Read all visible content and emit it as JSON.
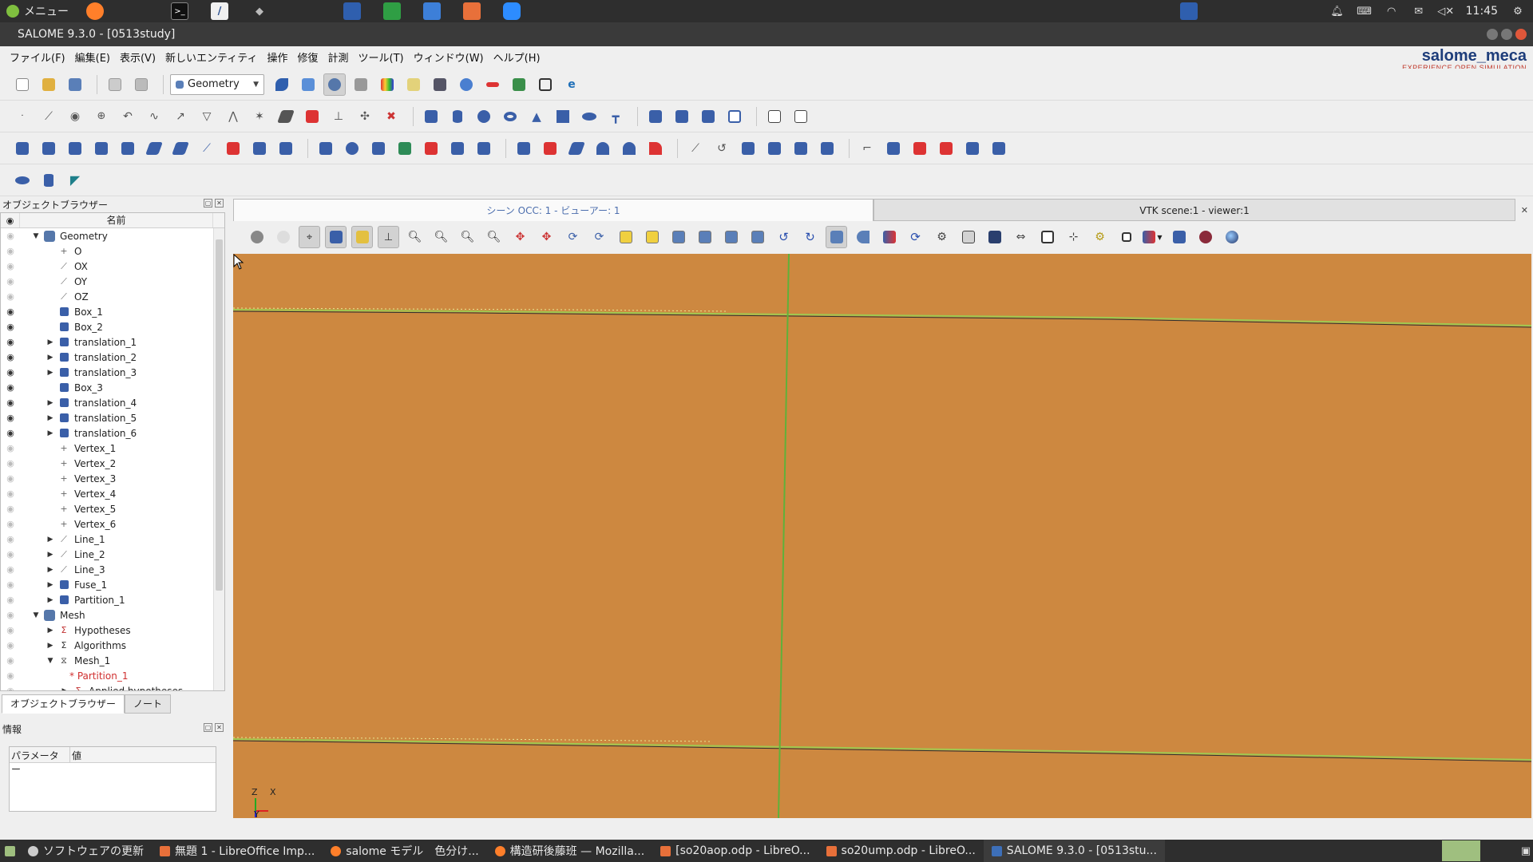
{
  "system_panel": {
    "menu_label": "メニュー",
    "clock": "11:45"
  },
  "window": {
    "title": "SALOME 9.3.0 - [0513study]"
  },
  "menubar": {
    "items": [
      "ファイル(F)",
      "編集(E)",
      "表示(V)",
      "新しいエンティティ",
      "操作",
      "修復",
      "計測",
      "ツール(T)",
      "ウィンドウ(W)",
      "ヘルプ(H)"
    ]
  },
  "brand": {
    "name": "salome_meca",
    "tagline": "EXPERIENCE OPEN SIMULATION"
  },
  "module_selector": {
    "value": "Geometry"
  },
  "object_browser": {
    "title": "オブジェクトブラウザー",
    "column_name": "名前",
    "rows": [
      {
        "label": "Geometry",
        "level": 0,
        "expand": "open",
        "icon": "geometry-component-icon",
        "eye": false
      },
      {
        "label": "O",
        "level": 1,
        "expand": "",
        "icon": "point-icon",
        "eye": false
      },
      {
        "label": "OX",
        "level": 1,
        "expand": "",
        "icon": "vector-icon",
        "eye": false
      },
      {
        "label": "OY",
        "level": 1,
        "expand": "",
        "icon": "vector-icon",
        "eye": false
      },
      {
        "label": "OZ",
        "level": 1,
        "expand": "",
        "icon": "vector-icon",
        "eye": false
      },
      {
        "label": "Box_1",
        "level": 1,
        "expand": "",
        "icon": "solid-icon",
        "eye": true
      },
      {
        "label": "Box_2",
        "level": 1,
        "expand": "",
        "icon": "solid-icon",
        "eye": true
      },
      {
        "label": "translation_1",
        "level": 1,
        "expand": "closed",
        "icon": "solid-icon",
        "eye": true
      },
      {
        "label": "translation_2",
        "level": 1,
        "expand": "closed",
        "icon": "solid-icon",
        "eye": true
      },
      {
        "label": "translation_3",
        "level": 1,
        "expand": "closed",
        "icon": "solid-icon",
        "eye": true
      },
      {
        "label": "Box_3",
        "level": 1,
        "expand": "",
        "icon": "solid-icon",
        "eye": true
      },
      {
        "label": "translation_4",
        "level": 1,
        "expand": "closed",
        "icon": "solid-icon",
        "eye": true
      },
      {
        "label": "translation_5",
        "level": 1,
        "expand": "closed",
        "icon": "solid-icon",
        "eye": true
      },
      {
        "label": "translation_6",
        "level": 1,
        "expand": "closed",
        "icon": "solid-icon",
        "eye": true
      },
      {
        "label": "Vertex_1",
        "level": 1,
        "expand": "",
        "icon": "point-icon",
        "eye": false
      },
      {
        "label": "Vertex_2",
        "level": 1,
        "expand": "",
        "icon": "point-icon",
        "eye": false
      },
      {
        "label": "Vertex_3",
        "level": 1,
        "expand": "",
        "icon": "point-icon",
        "eye": false
      },
      {
        "label": "Vertex_4",
        "level": 1,
        "expand": "",
        "icon": "point-icon",
        "eye": false
      },
      {
        "label": "Vertex_5",
        "level": 1,
        "expand": "",
        "icon": "point-icon",
        "eye": false
      },
      {
        "label": "Vertex_6",
        "level": 1,
        "expand": "",
        "icon": "point-icon",
        "eye": false
      },
      {
        "label": "Line_1",
        "level": 1,
        "expand": "closed",
        "icon": "vector-icon",
        "eye": false
      },
      {
        "label": "Line_2",
        "level": 1,
        "expand": "closed",
        "icon": "vector-icon",
        "eye": false
      },
      {
        "label": "Line_3",
        "level": 1,
        "expand": "closed",
        "icon": "vector-icon",
        "eye": false
      },
      {
        "label": "Fuse_1",
        "level": 1,
        "expand": "closed",
        "icon": "solid-icon",
        "eye": false
      },
      {
        "label": "Partition_1",
        "level": 1,
        "expand": "closed",
        "icon": "partition-icon",
        "eye": false
      },
      {
        "label": "Mesh",
        "level": 0,
        "expand": "open",
        "icon": "mesh-component-icon",
        "eye": false
      },
      {
        "label": "Hypotheses",
        "level": 1,
        "expand": "closed",
        "icon": "hypotheses-icon",
        "eye": false
      },
      {
        "label": "Algorithms",
        "level": 1,
        "expand": "closed",
        "icon": "algorithms-icon",
        "eye": false
      },
      {
        "label": "Mesh_1",
        "level": 1,
        "expand": "open",
        "icon": "mesh-object-icon",
        "eye": false
      },
      {
        "label": "* Partition_1",
        "level": 2,
        "expand": "",
        "icon": "",
        "eye": false,
        "red": true
      },
      {
        "label": "Applied hypotheses",
        "level": 2,
        "expand": "closed",
        "icon": "hypotheses-icon",
        "eye": false
      }
    ],
    "tabs": [
      "オブジェクトブラウザー",
      "ノート"
    ]
  },
  "info_panel": {
    "title": "情報",
    "columns": [
      "パラメーター",
      "値"
    ]
  },
  "viewer": {
    "tabs": [
      "シーン OCC: 1 - ビューアー: 1",
      "VTK scene:1 - viewer:1"
    ],
    "background_color": "#cd8840",
    "triad": {
      "z": "Z",
      "x": "X",
      "y": "Y"
    }
  },
  "taskbar": {
    "tasks": [
      {
        "label": "ソフトウェアの更新",
        "icon": "update-icon",
        "color": "#cccccc"
      },
      {
        "label": "無題 1 - LibreOffice Imp...",
        "icon": "impress-icon",
        "color": "#e8703a"
      },
      {
        "label": "salome モデル　色分け...",
        "icon": "firefox-icon",
        "color": "#ff7f2a"
      },
      {
        "label": "構造研後藤班 — Mozilla...",
        "icon": "firefox-icon",
        "color": "#ff7f2a"
      },
      {
        "label": "[so20aop.odp - LibreO...",
        "icon": "impress-icon",
        "color": "#e8703a"
      },
      {
        "label": "so20ump.odp - LibreO...",
        "icon": "impress-icon",
        "color": "#e8703a"
      },
      {
        "label": "SALOME 9.3.0 - [0513stu...",
        "icon": "salome-icon",
        "color": "#3d6fb8"
      }
    ]
  }
}
